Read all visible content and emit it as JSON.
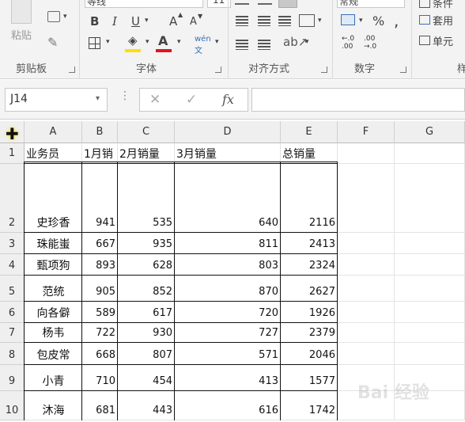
{
  "ribbon": {
    "clipboard": {
      "paste_label": "粘贴",
      "group_label": "剪贴板"
    },
    "font": {
      "font_name": "等线",
      "font_size": "11",
      "bold": "B",
      "italic": "I",
      "underline": "U",
      "grow": "A",
      "shrink": "A",
      "fill_color": "#ffe000",
      "font_color": "#e0141e",
      "phonetic": "wén",
      "group_label": "字体"
    },
    "align": {
      "group_label": "对齐方式"
    },
    "number": {
      "format": "常规",
      "percent": "%",
      "comma": ",",
      "inc_decimal": ".0 .00",
      "dec_decimal": ".00 .0",
      "group_label": "数字"
    },
    "styles": {
      "conditional": "条件",
      "table": "套用",
      "cell": "单元",
      "group_label": "样"
    }
  },
  "formula_bar": {
    "name_box": "J14",
    "cancel": "✕",
    "enter": "✓",
    "fx": "fx",
    "formula": ""
  },
  "columns": [
    "A",
    "B",
    "C",
    "D",
    "E",
    "F",
    "G"
  ],
  "header_row": {
    "row": "1",
    "a": "业务员",
    "b": "1月销",
    "c": "2月销量",
    "d": "3月销量",
    "e": "总销量"
  },
  "rows": [
    {
      "row": "2",
      "name": "史珍香",
      "b": "941",
      "c": "535",
      "d": "640",
      "e": "2116"
    },
    {
      "row": "3",
      "name": "珠能蚩",
      "b": "667",
      "c": "935",
      "d": "811",
      "e": "2413"
    },
    {
      "row": "4",
      "name": "甄项狗",
      "b": "893",
      "c": "628",
      "d": "803",
      "e": "2324"
    },
    {
      "row": "5",
      "name": "范统",
      "b": "905",
      "c": "852",
      "d": "870",
      "e": "2627"
    },
    {
      "row": "6",
      "name": "向各僻",
      "b": "589",
      "c": "617",
      "d": "720",
      "e": "1926"
    },
    {
      "row": "7",
      "name": "杨韦",
      "b": "722",
      "c": "930",
      "d": "727",
      "e": "2379"
    },
    {
      "row": "8",
      "name": "包皮常",
      "b": "668",
      "c": "807",
      "d": "571",
      "e": "2046"
    },
    {
      "row": "9",
      "name": "小青",
      "b": "710",
      "c": "454",
      "d": "413",
      "e": "1577"
    },
    {
      "row": "10",
      "name": "沐海",
      "b": "681",
      "c": "443",
      "d": "616",
      "e": "1742"
    }
  ],
  "watermark": "Bai 经验"
}
